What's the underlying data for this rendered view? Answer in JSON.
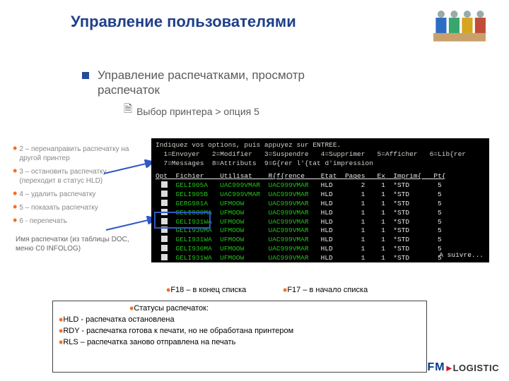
{
  "title": "Управление пользователями",
  "subtitle": "Управление распечатками, просмотр распечаток",
  "subline": "Выбор принтера > опция 5",
  "side_options": [
    "2 – перенаправить распечатку на другой принтер",
    "3 – остановить распечатку (переходит в статус HLD)",
    "4 – удалить распечатку",
    "5 – показать распечатку",
    "6 - перепечать"
  ],
  "footnote": "Имя распечатки (из таблицы DOC, меню C0 INFOLOG)",
  "terminal": {
    "header1": "Indiquez vos options, puis appuyez sur ENTREE.",
    "header2": "  1=Envoyer   2=Modifier   3=Suspendre   4=Supprimer   5=Afficher   6=Lib{rer",
    "header3": "  7=Messages  8=Attributs  9=G{rer l'{tat d'impression",
    "cols": "Opt  Fichier    Utilisat    R{f{rence    Etat  Pages   Ex  Imprim{   Pt{",
    "rows": [
      {
        "file": "GELI905A",
        "user": "UAC999VMAR",
        "ref": "UAC999VMAR",
        "etat": "HLD",
        "pages": "2",
        "ex": "1",
        "imp": "*STD",
        "pt": "5"
      },
      {
        "file": "GELI905B",
        "user": "UAC999VMAR",
        "ref": "UAC999VMAR",
        "etat": "HLD",
        "pages": "1",
        "ex": "1",
        "imp": "*STD",
        "pt": "5"
      },
      {
        "file": "GERG981A",
        "user": "UFMOOW",
        "ref": "UAC999VMAR",
        "etat": "HLD",
        "pages": "1",
        "ex": "1",
        "imp": "*STD",
        "pt": "5"
      },
      {
        "file": "GELI930MA",
        "user": "UFMOOW",
        "ref": "UAC999VMAR",
        "etat": "HLD",
        "pages": "1",
        "ex": "1",
        "imp": "*STD",
        "pt": "5"
      },
      {
        "file": "GELI931WA",
        "user": "UFMOOW",
        "ref": "UAC999VMAR",
        "etat": "HLD",
        "pages": "1",
        "ex": "1",
        "imp": "*STD",
        "pt": "5"
      },
      {
        "file": "GELI930MA",
        "user": "UFMOOW",
        "ref": "UAC999VMAR",
        "etat": "HLD",
        "pages": "1",
        "ex": "1",
        "imp": "*STD",
        "pt": "5"
      },
      {
        "file": "GELI931WA",
        "user": "UFMOOW",
        "ref": "UAC999VMAR",
        "etat": "HLD",
        "pages": "1",
        "ex": "1",
        "imp": "*STD",
        "pt": "5"
      },
      {
        "file": "GELI930MA",
        "user": "UFMOOW",
        "ref": "UAC999VMAR",
        "etat": "HLD",
        "pages": "1",
        "ex": "1",
        "imp": "*STD",
        "pt": "5"
      },
      {
        "file": "GELI931WA",
        "user": "UFMOOW",
        "ref": "UAC999VMAR",
        "etat": "HLD",
        "pages": "1",
        "ex": "1",
        "imp": "*STD",
        "pt": "5"
      }
    ],
    "more": "A suivre..."
  },
  "fkeys": {
    "f18": "F18 – в конец списка",
    "f17": "F17 – в начало списка"
  },
  "status": {
    "title": "Статусы распечаток:",
    "lines": [
      "HLD - распечатка остановлена",
      "RDY - распечатка готова к печати, но не обработана принтером",
      "RLS – распечатка заново отправлена на печать"
    ]
  },
  "logo": {
    "fm": "FM",
    "tail": "LOGISTIC"
  }
}
